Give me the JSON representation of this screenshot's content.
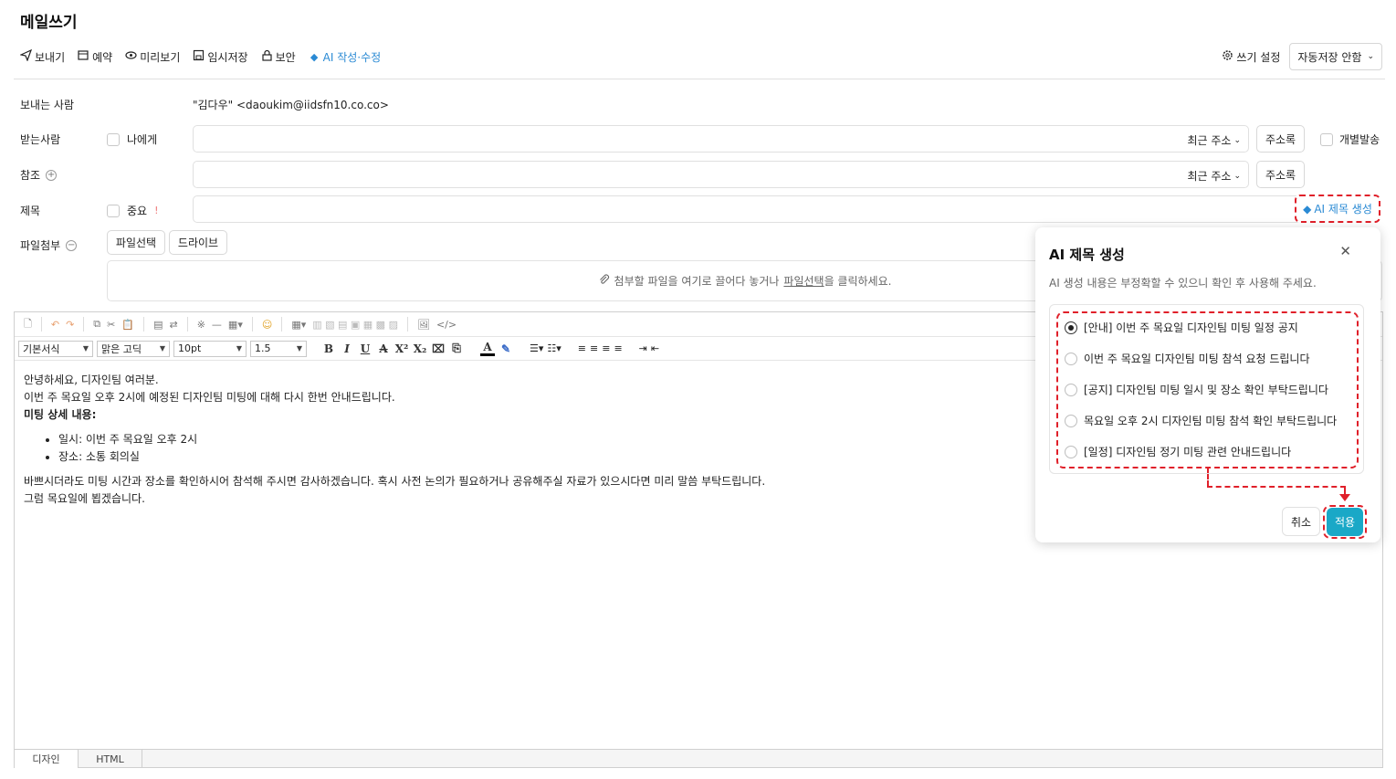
{
  "page_title": "메일쓰기",
  "toolbar": {
    "send": "보내기",
    "schedule": "예약",
    "preview": "미리보기",
    "draft": "임시저장",
    "security": "보안",
    "ai_edit": "AI 작성·수정"
  },
  "top_right": {
    "write_settings": "쓰기 설정",
    "autosave": "자동저장 안함"
  },
  "form": {
    "sender_label": "보내는 사람",
    "sender_value": "\"김다우\" <daoukim@iidsfn10.co.co>",
    "recipient_label": "받는사람",
    "to_me": "나에게",
    "recent_address": "최근 주소",
    "address_book": "주소록",
    "individual_send": "개별발송",
    "cc_label": "참조",
    "subject_label": "제목",
    "important": "중요",
    "ai_subject_button": "AI 제목 생성",
    "attachment_label": "파일첨부",
    "file_select": "파일선택",
    "drive": "드라이브",
    "drop_text_before": "첨부할 파일을 여기로 끌어다 놓거나 ",
    "drop_text_link": "파일선택",
    "drop_text_after": "을 클릭하세요."
  },
  "editor": {
    "style_select": "기본서식",
    "font_select": "맑은 고딕",
    "size_select": "10pt",
    "line_select": "1.5",
    "body": {
      "line1": "안녕하세요, 디자인팀 여러분.",
      "line2": "이번 주 목요일 오후 2시에 예정된 디자인팀 미팅에 대해 다시 한번 안내드립니다.",
      "line3": "미팅 상세 내용:",
      "bullet1": "일시: 이번 주 목요일 오후 2시",
      "bullet2": "장소: 소통 회의실",
      "line4": "바쁘시더라도 미팅 시간과 장소를 확인하시어 참석해 주시면 감사하겠습니다. 혹시 사전 논의가 필요하거나 공유해주실 자료가 있으시다면 미리 말씀 부탁드립니다.",
      "line5": "그럼 목요일에 뵙겠습니다."
    },
    "tab_design": "디자인",
    "tab_html": "HTML"
  },
  "popup": {
    "title": "AI 제목 생성",
    "subtitle": "AI 생성 내용은 부정확할 수 있으니 확인 후 사용해 주세요.",
    "options": [
      "[안내] 이번 주 목요일 디자인팀 미팅 일정 공지",
      "이번 주 목요일 디자인팀 미팅 참석 요청 드립니다",
      "[공지] 디자인팀 미팅 일시 및 장소 확인 부탁드립니다",
      "목요일 오후 2시 디자인팀 미팅 참석 확인 부탁드립니다",
      "[일정] 디자인팀 정기 미팅 관련 안내드립니다"
    ],
    "cancel": "취소",
    "apply": "적용"
  },
  "colors": {
    "ai_blue": "#2a8ad4",
    "highlight_red": "#e0202a",
    "apply_button": "#1aa8c7"
  }
}
